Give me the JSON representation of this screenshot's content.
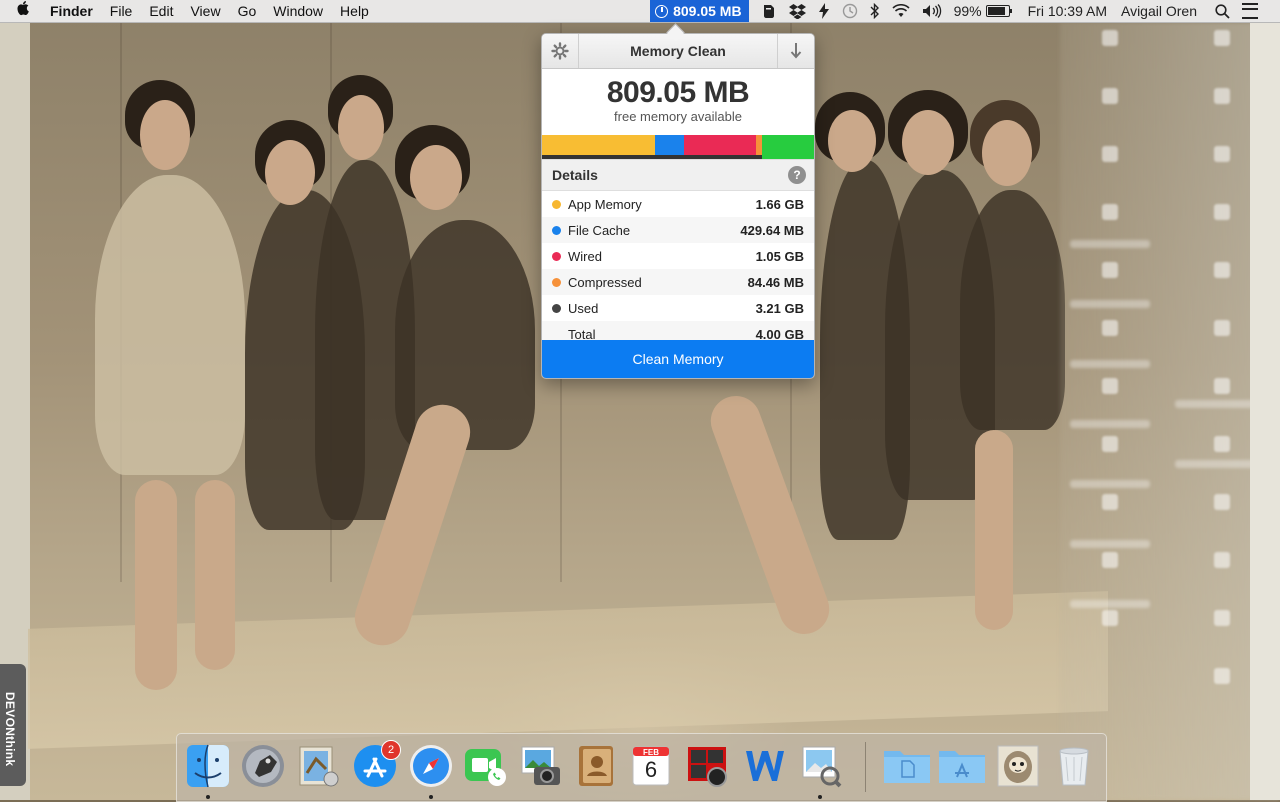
{
  "menubar": {
    "finder": "Finder",
    "menus": [
      "File",
      "Edit",
      "View",
      "Go",
      "Window",
      "Help"
    ],
    "memory_status": "809.05 MB",
    "battery": "99%",
    "battery_level": 0.99,
    "clock": "Fri 10:39 AM",
    "user": "Avigail Oren"
  },
  "popover": {
    "title": "Memory Clean",
    "free_value": "809.05 MB",
    "free_label": "free memory available",
    "details_label": "Details",
    "help": "?",
    "rows": [
      {
        "name": "App Memory",
        "value": "1.66 GB",
        "color": "#f7b731"
      },
      {
        "name": "File Cache",
        "value": "429.64 MB",
        "color": "#1a82ec"
      },
      {
        "name": "Wired",
        "value": "1.05 GB",
        "color": "#ea2a55"
      },
      {
        "name": "Compressed",
        "value": "84.46 MB",
        "color": "#f6913a"
      },
      {
        "name": "Used",
        "value": "3.21 GB",
        "color": "#444444"
      },
      {
        "name": "Total",
        "value": "4.00 GB"
      }
    ],
    "bar_colors": {
      "app": "#f8bd33",
      "cache": "#1a82ec",
      "wired": "#ea2a55",
      "compressed": "#f6913a",
      "free": "#27cc3f"
    },
    "clean_button": "Clean Memory"
  },
  "side_tab": "DEVONthink",
  "dock": {
    "app_store_badge": "2",
    "calendar_month": "FEB",
    "calendar_day": "6"
  }
}
